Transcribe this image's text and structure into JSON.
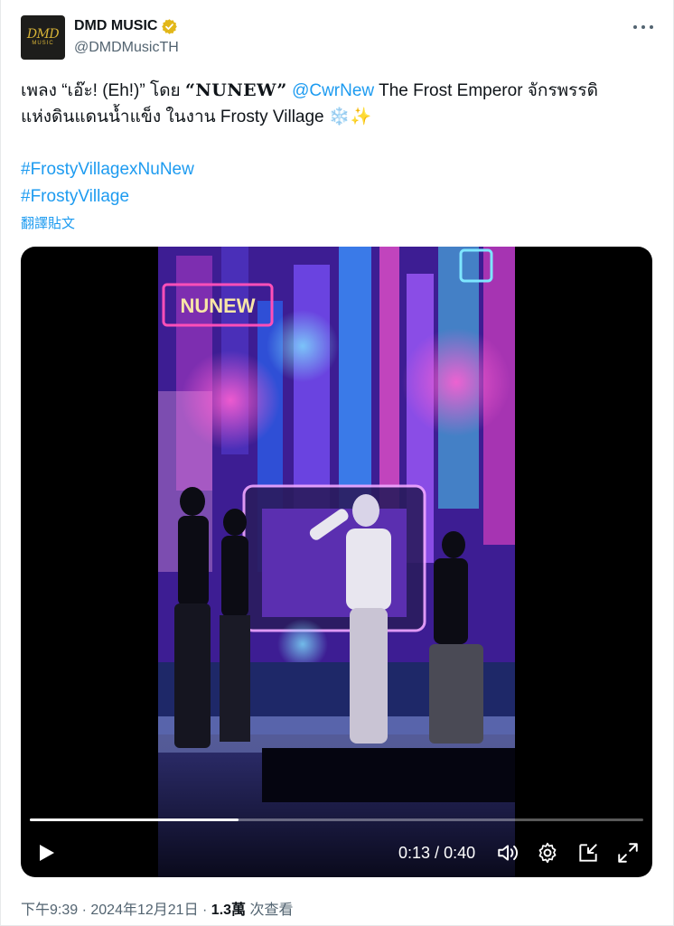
{
  "author": {
    "avatar_text": "DMD",
    "avatar_subtext": "MUSIC",
    "display_name": "DMD MUSIC",
    "handle": "@DMDMusicTH",
    "verified_color": "#e2b719"
  },
  "tweet": {
    "line1_prefix": "เพลง “เอ๊ะ! (Eh!)” โดย ",
    "line1_quote": "“NUNEW”",
    "line1_mention": "@CwrNew",
    "line1_suffix": " The Frost Emperor จักรพรรดิ",
    "line2": "แห่งดินแดนน้ำแข็ง ในงาน Frosty Village ❄️✨",
    "hashtags": [
      "#FrostyVillagexNuNew",
      "#FrostyVillage"
    ],
    "translate_label": "翻譯貼文"
  },
  "video": {
    "sign_text": "NUNEW",
    "current_time": "0:13",
    "separator": " / ",
    "duration": "0:40",
    "progress": 0.34
  },
  "meta": {
    "time": "下午9:39",
    "dot1": " · ",
    "date": "2024年12月21日",
    "dot2": " · ",
    "views_count": "1.3萬",
    "views_label": " 次查看"
  },
  "colors": {
    "link": "#1d9bf0",
    "muted": "#536471",
    "text": "#0f1419"
  }
}
